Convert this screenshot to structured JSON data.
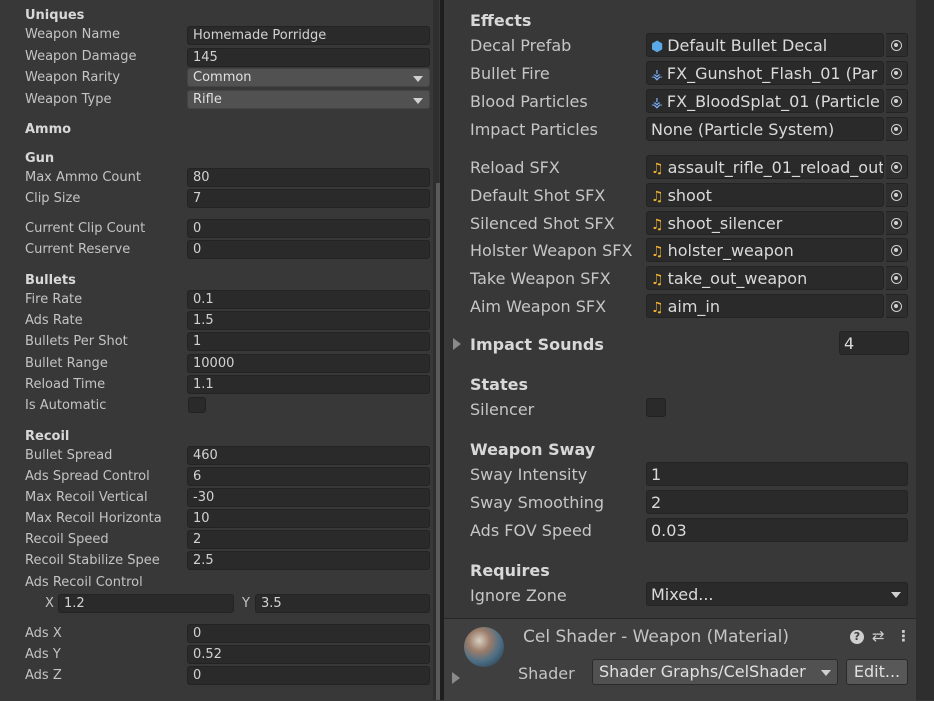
{
  "left": {
    "uniques_header": "Uniques",
    "weapon_name": {
      "label": "Weapon Name",
      "value": "Homemade Porridge"
    },
    "weapon_damage": {
      "label": "Weapon Damage",
      "value": "145"
    },
    "weapon_rarity": {
      "label": "Weapon Rarity",
      "value": "Common"
    },
    "weapon_type": {
      "label": "Weapon Type",
      "value": "Rifle"
    },
    "ammo_header": "Ammo",
    "gun_header": "Gun",
    "max_ammo": {
      "label": "Max Ammo Count",
      "value": "80"
    },
    "clip_size": {
      "label": "Clip Size",
      "value": "7"
    },
    "current_clip": {
      "label": "Current Clip Count",
      "value": "0"
    },
    "current_reserve": {
      "label": "Current Reserve",
      "value": "0"
    },
    "bullets_header": "Bullets",
    "fire_rate": {
      "label": "Fire Rate",
      "value": "0.1"
    },
    "ads_rate": {
      "label": "Ads Rate",
      "value": "1.5"
    },
    "bullets_per_shot": {
      "label": "Bullets Per Shot",
      "value": "1"
    },
    "bullet_range": {
      "label": "Bullet Range",
      "value": "10000"
    },
    "reload_time": {
      "label": "Reload Time",
      "value": "1.1"
    },
    "is_automatic": {
      "label": "Is Automatic",
      "checked": false
    },
    "recoil_header": "Recoil",
    "bullet_spread": {
      "label": "Bullet Spread",
      "value": "460"
    },
    "ads_spread_control": {
      "label": "Ads Spread Control",
      "value": "6"
    },
    "max_recoil_vertical": {
      "label": "Max Recoil Vertical",
      "value": "-30"
    },
    "max_recoil_horizontal": {
      "label": "Max Recoil Horizonta",
      "value": "10"
    },
    "recoil_speed": {
      "label": "Recoil Speed",
      "value": "2"
    },
    "recoil_stabilize_speed": {
      "label": "Recoil Stabilize Spee",
      "value": "2.5"
    },
    "ads_recoil_control": {
      "label": "Ads Recoil Control",
      "x_label": "X",
      "x": "1.2",
      "y_label": "Y",
      "y": "3.5"
    },
    "ads_x": {
      "label": "Ads X",
      "value": "0"
    },
    "ads_y": {
      "label": "Ads Y",
      "value": "0.52"
    },
    "ads_z": {
      "label": "Ads Z",
      "value": "0"
    }
  },
  "right": {
    "effects_header": "Effects",
    "decal_prefab": {
      "label": "Decal Prefab",
      "value": "Default Bullet Decal",
      "icon": "prefab-cube-icon"
    },
    "bullet_fire": {
      "label": "Bullet Fire",
      "value": "FX_Gunshot_Flash_01 (Par",
      "icon": "particle-system-icon"
    },
    "blood_particles": {
      "label": "Blood Particles",
      "value": "FX_BloodSplat_01 (Particle",
      "icon": "particle-system-icon"
    },
    "impact_particles": {
      "label": "Impact Particles",
      "value": "None (Particle System)"
    },
    "reload_sfx": {
      "label": "Reload SFX",
      "value": "assault_rifle_01_reload_out",
      "icon": "audio-clip-icon"
    },
    "default_shot_sfx": {
      "label": "Default Shot SFX",
      "value": "shoot",
      "icon": "audio-clip-icon"
    },
    "silenced_shot_sfx": {
      "label": "Silenced Shot SFX",
      "value": "shoot_silencer",
      "icon": "audio-clip-icon"
    },
    "holster_weapon_sfx": {
      "label": "Holster Weapon SFX",
      "value": "holster_weapon",
      "icon": "audio-clip-icon"
    },
    "take_weapon_sfx": {
      "label": "Take Weapon SFX",
      "value": "take_out_weapon",
      "icon": "audio-clip-icon"
    },
    "aim_weapon_sfx": {
      "label": "Aim Weapon SFX",
      "value": "aim_in",
      "icon": "audio-clip-icon"
    },
    "impact_sounds": {
      "label": "Impact Sounds",
      "count": "4"
    },
    "states_header": "States",
    "silencer": {
      "label": "Silencer",
      "checked": false
    },
    "weapon_sway_header": "Weapon Sway",
    "sway_intensity": {
      "label": "Sway Intensity",
      "value": "1"
    },
    "sway_smoothing": {
      "label": "Sway Smoothing",
      "value": "2"
    },
    "ads_fov_speed": {
      "label": "Ads FOV Speed",
      "value": "0.03"
    },
    "requires_header": "Requires",
    "ignore_zone": {
      "label": "Ignore Zone",
      "value": "Mixed..."
    }
  },
  "material": {
    "title": "Cel Shader - Weapon (Material)",
    "shader_label": "Shader",
    "shader_value": "Shader Graphs/CelShader",
    "edit_label": "Edit...",
    "help_glyph": "?",
    "settings_glyph": "⇄",
    "more_glyph": "⋮"
  },
  "icons": {
    "cube": "⬢",
    "particle": "⚶",
    "audio": "♫"
  },
  "colors": {
    "background": "#383838",
    "field": "#2a2a2a",
    "dropdown": "#515151",
    "audio_icon": "#f2b530",
    "prefab_icon": "#5aa9e6"
  }
}
